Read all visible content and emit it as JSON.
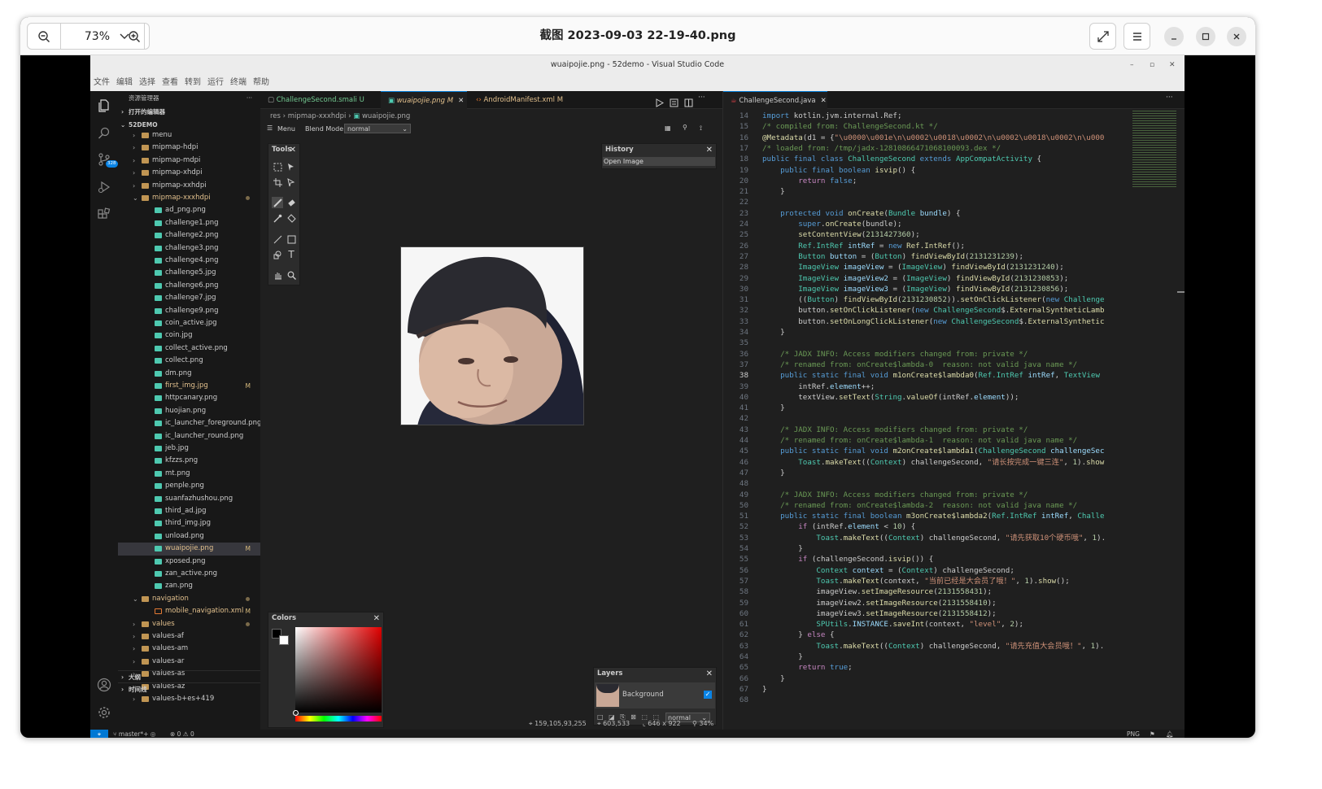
{
  "viewer": {
    "zoom": "73%",
    "title": "截图 2023-09-03 22-19-40.png"
  },
  "vscode": {
    "title": "wuaipojie.png - 52demo - Visual Studio Code",
    "menu": [
      "文件",
      "编辑",
      "选择",
      "查看",
      "转到",
      "运行",
      "终端",
      "帮助"
    ],
    "explorer_title": "资源管理器",
    "open_editors": "打开的编辑器",
    "project": "52DEMO",
    "badge": "328",
    "outline": "大纲",
    "timeline": "时间线",
    "tree": [
      {
        "label": "menu",
        "type": "folder",
        "level": 1,
        "partial": true
      },
      {
        "label": "mipmap-hdpi",
        "type": "folder",
        "level": 1
      },
      {
        "label": "mipmap-mdpi",
        "type": "folder",
        "level": 1
      },
      {
        "label": "mipmap-xhdpi",
        "type": "folder",
        "level": 1
      },
      {
        "label": "mipmap-xxhdpi",
        "type": "folder",
        "level": 1
      },
      {
        "label": "mipmap-xxxhdpi",
        "type": "folder-open",
        "level": 1,
        "dot": true
      },
      {
        "label": "ad_png.png",
        "type": "img",
        "level": 2
      },
      {
        "label": "challenge1.png",
        "type": "img",
        "level": 2
      },
      {
        "label": "challenge2.png",
        "type": "img",
        "level": 2
      },
      {
        "label": "challenge3.png",
        "type": "img",
        "level": 2
      },
      {
        "label": "challenge4.png",
        "type": "img",
        "level": 2
      },
      {
        "label": "challenge5.jpg",
        "type": "img",
        "level": 2
      },
      {
        "label": "challenge6.png",
        "type": "img",
        "level": 2
      },
      {
        "label": "challenge7.jpg",
        "type": "img",
        "level": 2
      },
      {
        "label": "challenge9.png",
        "type": "img",
        "level": 2
      },
      {
        "label": "coin_active.jpg",
        "type": "img",
        "level": 2
      },
      {
        "label": "coin.jpg",
        "type": "img",
        "level": 2
      },
      {
        "label": "collect_active.png",
        "type": "img",
        "level": 2
      },
      {
        "label": "collect.png",
        "type": "img",
        "level": 2
      },
      {
        "label": "dm.png",
        "type": "img",
        "level": 2
      },
      {
        "label": "first_img.jpg",
        "type": "img",
        "level": 2,
        "status": "M"
      },
      {
        "label": "httpcanary.png",
        "type": "img",
        "level": 2
      },
      {
        "label": "huojian.png",
        "type": "img",
        "level": 2
      },
      {
        "label": "ic_launcher_foreground.png",
        "type": "img",
        "level": 2
      },
      {
        "label": "ic_launcher_round.png",
        "type": "img",
        "level": 2
      },
      {
        "label": "jeb.jpg",
        "type": "img",
        "level": 2
      },
      {
        "label": "kfzzs.png",
        "type": "img",
        "level": 2
      },
      {
        "label": "mt.png",
        "type": "img",
        "level": 2
      },
      {
        "label": "penple.png",
        "type": "img",
        "level": 2
      },
      {
        "label": "suanfazhushou.png",
        "type": "img",
        "level": 2
      },
      {
        "label": "third_ad.jpg",
        "type": "img",
        "level": 2
      },
      {
        "label": "third_img.jpg",
        "type": "img",
        "level": 2
      },
      {
        "label": "unload.png",
        "type": "img",
        "level": 2
      },
      {
        "label": "wuaipojie.png",
        "type": "img",
        "level": 2,
        "status": "M",
        "selected": true
      },
      {
        "label": "xposed.png",
        "type": "img",
        "level": 2
      },
      {
        "label": "zan_active.png",
        "type": "img",
        "level": 2
      },
      {
        "label": "zan.png",
        "type": "img",
        "level": 2
      },
      {
        "label": "navigation",
        "type": "folder-open",
        "level": 1,
        "dot": true
      },
      {
        "label": "mobile_navigation.xml",
        "type": "xml",
        "level": 2,
        "status": "M"
      },
      {
        "label": "values",
        "type": "folder",
        "level": 1,
        "dot": true
      },
      {
        "label": "values-af",
        "type": "folder",
        "level": 1
      },
      {
        "label": "values-am",
        "type": "folder",
        "level": 1
      },
      {
        "label": "values-ar",
        "type": "folder",
        "level": 1
      },
      {
        "label": "values-as",
        "type": "folder",
        "level": 1
      },
      {
        "label": "values-az",
        "type": "folder",
        "level": 1
      },
      {
        "label": "values-b+es+419",
        "type": "folder",
        "level": 1
      }
    ],
    "tabs_left": [
      {
        "label": "ChallengeSecond.smali",
        "mark": "U"
      },
      {
        "label": "wuaipojie.png",
        "mark": "M",
        "active": true
      },
      {
        "label": "AndroidManifest.xml",
        "mark": "M"
      }
    ],
    "tab_right": "ChallengeSecond.java",
    "breadcrumb": [
      "res",
      "mipmap-xxxhdpi",
      "wuaipojie.png"
    ],
    "image_editor": {
      "menu_label": "Menu",
      "blend_label": "Blend Mode:",
      "blend_value": "normal",
      "tools_title": "Tools",
      "history_title": "History",
      "history_item": "Open Image",
      "colors_title": "Colors",
      "layers_title": "Layers",
      "layer_name": "Background",
      "layer_blend": "normal",
      "status_cursor": "159,105,93,255",
      "status_pos": "603,533",
      "status_size": "646 x 922",
      "status_zoom": "34%"
    },
    "code_lines": [
      {
        "n": 14,
        "h": "<span class=\"k\">import</span> kotlin.jvm.internal.Ref;"
      },
      {
        "n": 15,
        "h": "<span class=\"c\">/* compiled from: ChallengeSecond.kt */</span>"
      },
      {
        "n": 16,
        "h": "<span class=\"a\">@Metadata</span>(d1 = {<span class=\"s\">\"\\u0000\\u001e\\n\\u0002\\u0018\\u0002\\n\\u0002\\u0018\\u0002\\n\\u000</span>"
      },
      {
        "n": 17,
        "h": "<span class=\"c\">/* loaded from: /tmp/jadx-12810866471068100093.dex */</span>"
      },
      {
        "n": 18,
        "h": "<span class=\"k\">public final class</span> <span class=\"t\">ChallengeSecond</span> <span class=\"k\">extends</span> <span class=\"t\">AppCompatActivity</span> {"
      },
      {
        "n": 19,
        "h": "    <span class=\"k\">public final boolean</span> <span class=\"f\">isvip</span>() {"
      },
      {
        "n": 20,
        "h": "        <span class=\"p\">return</span> <span class=\"k\">false</span>;"
      },
      {
        "n": 21,
        "h": "    }"
      },
      {
        "n": 22,
        "h": ""
      },
      {
        "n": 23,
        "h": "    <span class=\"k\">protected void</span> <span class=\"f\">onCreate</span>(<span class=\"t\">Bundle</span> <span class=\"v\">bundle</span>) {"
      },
      {
        "n": 24,
        "h": "        <span class=\"k\">super</span>.<span class=\"f\">onCreate</span>(bundle);"
      },
      {
        "n": 25,
        "h": "        <span class=\"f\">setContentView</span>(<span class=\"n\">2131427360</span>);"
      },
      {
        "n": 26,
        "h": "        <span class=\"t\">Ref.IntRef</span> <span class=\"v\">intRef</span> = <span class=\"k\">new</span> <span class=\"f\">Ref.IntRef</span>();"
      },
      {
        "n": 27,
        "h": "        <span class=\"t\">Button</span> <span class=\"v\">button</span> = (<span class=\"t\">Button</span>) <span class=\"f\">findViewById</span>(<span class=\"n\">2131231239</span>);"
      },
      {
        "n": 28,
        "h": "        <span class=\"t\">ImageView</span> <span class=\"v\">imageView</span> = (<span class=\"t\">ImageView</span>) <span class=\"f\">findViewById</span>(<span class=\"n\">2131231240</span>);"
      },
      {
        "n": 29,
        "h": "        <span class=\"t\">ImageView</span> <span class=\"v\">imageView2</span> = (<span class=\"t\">ImageView</span>) <span class=\"f\">findViewById</span>(<span class=\"n\">2131230853</span>);"
      },
      {
        "n": 30,
        "h": "        <span class=\"t\">ImageView</span> <span class=\"v\">imageView3</span> = (<span class=\"t\">ImageView</span>) <span class=\"f\">findViewById</span>(<span class=\"n\">2131230856</span>);"
      },
      {
        "n": 31,
        "h": "        ((<span class=\"t\">Button</span>) <span class=\"f\">findViewById</span>(<span class=\"n\">2131230852</span>)).<span class=\"f\">setOnClickListener</span>(<span class=\"k\">new</span> <span class=\"t\">Challenge</span>"
      },
      {
        "n": 32,
        "h": "        button.<span class=\"f\">setOnClickListener</span>(<span class=\"k\">new</span> <span class=\"t\">ChallengeSecond</span>$.<span class=\"f\">ExternalSyntheticLamb</span>"
      },
      {
        "n": 33,
        "h": "        button.<span class=\"f\">setOnLongClickListener</span>(<span class=\"k\">new</span> <span class=\"t\">ChallengeSecond</span>$.<span class=\"f\">ExternalSynthetic</span>"
      },
      {
        "n": 34,
        "h": "    }"
      },
      {
        "n": 35,
        "h": ""
      },
      {
        "n": 36,
        "h": "    <span class=\"c\">/* JADX INFO: Access modifiers changed from: private */</span>"
      },
      {
        "n": 37,
        "h": "    <span class=\"c\">/* renamed from: onCreate$lambda-0  reason: not valid java name */</span>"
      },
      {
        "n": 38,
        "h": "    <span class=\"k\">public static final void</span> <span class=\"f\">m1onCreate$lambda0</span>(<span class=\"t\">Ref.IntRef</span> <span class=\"v\">intRef</span>, <span class=\"t\">TextView</span>",
        "cur": true
      },
      {
        "n": 39,
        "h": "        intRef.<span class=\"v\">element</span>++;"
      },
      {
        "n": 40,
        "h": "        textView.<span class=\"f\">setText</span>(<span class=\"t\">String</span>.<span class=\"f\">valueOf</span>(intRef.<span class=\"v\">element</span>));"
      },
      {
        "n": 41,
        "h": "    }"
      },
      {
        "n": 42,
        "h": ""
      },
      {
        "n": 43,
        "h": "    <span class=\"c\">/* JADX INFO: Access modifiers changed from: private */</span>"
      },
      {
        "n": 44,
        "h": "    <span class=\"c\">/* renamed from: onCreate$lambda-1  reason: not valid java name */</span>"
      },
      {
        "n": 45,
        "h": "    <span class=\"k\">public static final void</span> <span class=\"f\">m2onCreate$lambda1</span>(<span class=\"t\">ChallengeSecond</span> <span class=\"v\">challengeSec</span>"
      },
      {
        "n": 46,
        "h": "        <span class=\"t\">Toast</span>.<span class=\"f\">makeText</span>((<span class=\"t\">Context</span>) challengeSecond, <span class=\"s\">\"请长按完成一键三连\"</span>, <span class=\"n\">1</span>).<span class=\"f\">show</span>"
      },
      {
        "n": 47,
        "h": "    }"
      },
      {
        "n": 48,
        "h": ""
      },
      {
        "n": 49,
        "h": "    <span class=\"c\">/* JADX INFO: Access modifiers changed from: private */</span>"
      },
      {
        "n": 50,
        "h": "    <span class=\"c\">/* renamed from: onCreate$lambda-2  reason: not valid java name */</span>"
      },
      {
        "n": 51,
        "h": "    <span class=\"k\">public static final boolean</span> <span class=\"f\">m3onCreate$lambda2</span>(<span class=\"t\">Ref.IntRef</span> <span class=\"v\">intRef</span>, <span class=\"t\">Challe</span>"
      },
      {
        "n": 52,
        "h": "        <span class=\"p\">if</span> (intRef.<span class=\"v\">element</span> &lt; <span class=\"n\">10</span>) {"
      },
      {
        "n": 53,
        "h": "            <span class=\"t\">Toast</span>.<span class=\"f\">makeText</span>((<span class=\"t\">Context</span>) challengeSecond, <span class=\"s\">\"请先获取10个硬币哦\"</span>, <span class=\"n\">1</span>)."
      },
      {
        "n": 54,
        "h": "        }"
      },
      {
        "n": 55,
        "h": "        <span class=\"p\">if</span> (challengeSecond.<span class=\"f\">isvip</span>()) {"
      },
      {
        "n": 56,
        "h": "            <span class=\"t\">Context</span> <span class=\"v\">context</span> = (<span class=\"t\">Context</span>) challengeSecond;"
      },
      {
        "n": 57,
        "h": "            <span class=\"t\">Toast</span>.<span class=\"f\">makeText</span>(context, <span class=\"s\">\"当前已经是大会员了哦！\"</span>, <span class=\"n\">1</span>).<span class=\"f\">show</span>();"
      },
      {
        "n": 58,
        "h": "            imageView.<span class=\"f\">setImageResource</span>(<span class=\"n\">2131558431</span>);"
      },
      {
        "n": 59,
        "h": "            imageView2.<span class=\"f\">setImageResource</span>(<span class=\"n\">2131558410</span>);"
      },
      {
        "n": 60,
        "h": "            imageView3.<span class=\"f\">setImageResource</span>(<span class=\"n\">2131558412</span>);"
      },
      {
        "n": 61,
        "h": "            <span class=\"t\">SPUtils</span>.<span class=\"v\">INSTANCE</span>.<span class=\"f\">saveInt</span>(context, <span class=\"s\">\"level\"</span>, <span class=\"n\">2</span>);"
      },
      {
        "n": 62,
        "h": "        } <span class=\"p\">else</span> {"
      },
      {
        "n": 63,
        "h": "            <span class=\"t\">Toast</span>.<span class=\"f\">makeText</span>((<span class=\"t\">Context</span>) challengeSecond, <span class=\"s\">\"请先充值大会员哦！\"</span>, <span class=\"n\">1</span>)."
      },
      {
        "n": 64,
        "h": "        }"
      },
      {
        "n": 65,
        "h": "        <span class=\"p\">return</span> <span class=\"k\">true</span>;"
      },
      {
        "n": 66,
        "h": "    }"
      },
      {
        "n": 67,
        "h": "}"
      },
      {
        "n": 68,
        "h": ""
      }
    ],
    "status": {
      "branch": "master*+",
      "errors": "0",
      "warnings": "0",
      "filetype": "PNG"
    }
  }
}
